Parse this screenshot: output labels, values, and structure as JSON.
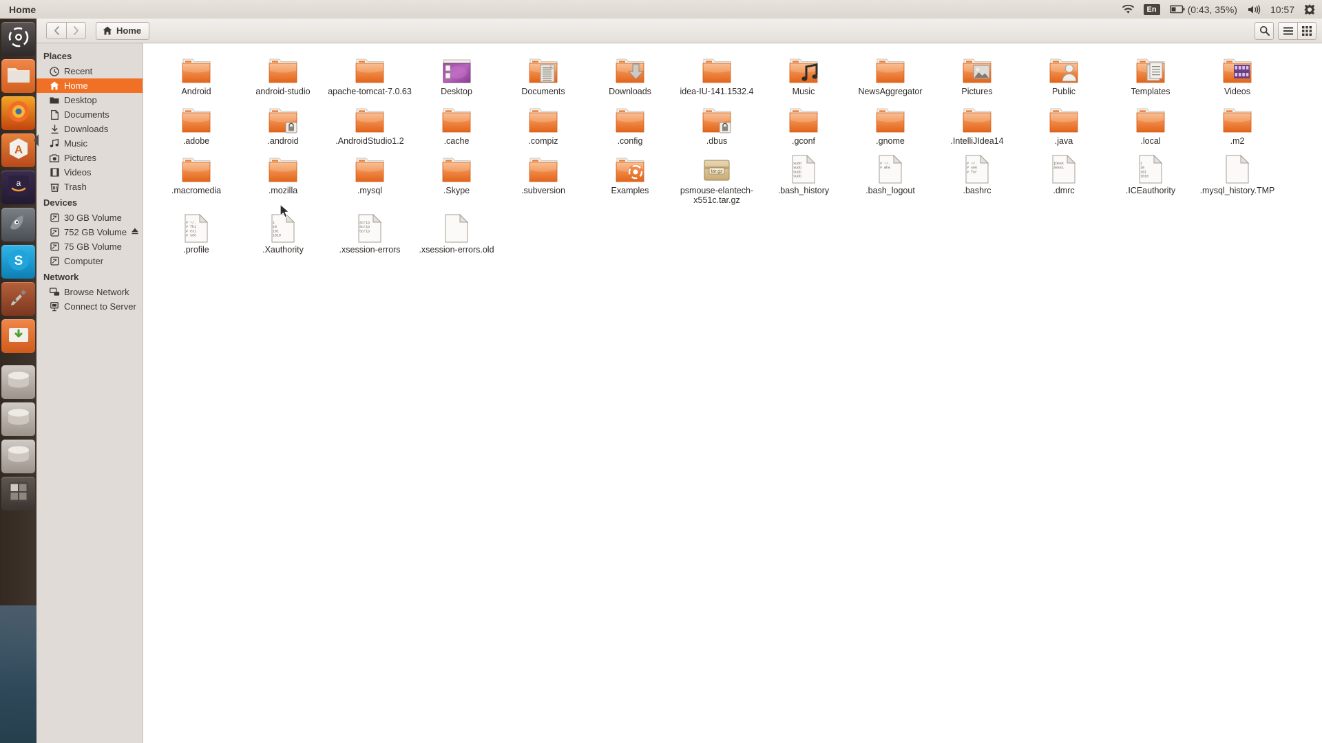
{
  "top_panel": {
    "title": "Home",
    "tray": {
      "wifi_icon": "wifi-icon",
      "keyboard_layout": "En",
      "battery_icon": "battery-icon",
      "battery_text": "(0:43, 35%)",
      "volume_icon": "volume-icon",
      "clock": "10:57",
      "session_icon": "gear-icon"
    }
  },
  "launcher": {
    "items": [
      {
        "name": "ubuntu-dash",
        "color1": "#5a5554",
        "color2": "#2e2a29",
        "glyph": "dash"
      },
      {
        "name": "files-nautilus",
        "color1": "#f0874b",
        "color2": "#d2601f",
        "glyph": "files"
      },
      {
        "name": "firefox",
        "color1": "#f5a623",
        "color2": "#c1440e",
        "glyph": "firefox"
      },
      {
        "name": "ubuntu-software-center",
        "color1": "#e8823c",
        "color2": "#b8491a",
        "glyph": "software"
      },
      {
        "name": "amazon",
        "color1": "#3a2b4e",
        "color2": "#221a30",
        "glyph": "amazon"
      },
      {
        "name": "gimp",
        "color1": "#7b7f86",
        "color2": "#4a4e54",
        "glyph": "gimp"
      },
      {
        "name": "skype",
        "color1": "#31b6e7",
        "color2": "#0d7fb5",
        "glyph": "skype"
      },
      {
        "name": "system-settings",
        "color1": "#b7603a",
        "color2": "#7a3720",
        "glyph": "settings"
      },
      {
        "name": "software-updater",
        "color1": "#f0874b",
        "color2": "#cf5b1c",
        "glyph": "updater"
      },
      {
        "name": "volume-30gb",
        "color1": "#cfcac4",
        "color2": "#9b948c",
        "glyph": "disk"
      },
      {
        "name": "volume-752gb",
        "color1": "#cfcac4",
        "color2": "#9b948c",
        "glyph": "disk"
      },
      {
        "name": "volume-75gb",
        "color1": "#cfcac4",
        "color2": "#9b948c",
        "glyph": "disk"
      },
      {
        "name": "workspace-switcher",
        "color1": "#5d5650",
        "color2": "#3a3531",
        "glyph": "workspace"
      }
    ]
  },
  "toolbar": {
    "back_label": "Back",
    "forward_label": "Forward",
    "path_label": "Home",
    "search_label": "Search",
    "view_list_label": "List view",
    "view_grid_label": "Icon view"
  },
  "sidebar": {
    "groups": [
      {
        "heading": "Places",
        "items": [
          {
            "label": "Recent",
            "icon": "clock-icon",
            "active": false
          },
          {
            "label": "Home",
            "icon": "home-icon",
            "active": true
          },
          {
            "label": "Desktop",
            "icon": "folder-icon",
            "active": false
          },
          {
            "label": "Documents",
            "icon": "document-icon",
            "active": false
          },
          {
            "label": "Downloads",
            "icon": "download-icon",
            "active": false
          },
          {
            "label": "Music",
            "icon": "music-icon",
            "active": false
          },
          {
            "label": "Pictures",
            "icon": "camera-icon",
            "active": false
          },
          {
            "label": "Videos",
            "icon": "film-icon",
            "active": false
          },
          {
            "label": "Trash",
            "icon": "trash-icon",
            "active": false
          }
        ]
      },
      {
        "heading": "Devices",
        "items": [
          {
            "label": "30 GB Volume",
            "icon": "drive-icon",
            "active": false
          },
          {
            "label": "752 GB Volume",
            "icon": "drive-icon",
            "active": false,
            "eject": true
          },
          {
            "label": "75 GB Volume",
            "icon": "drive-icon",
            "active": false
          },
          {
            "label": "Computer",
            "icon": "drive-icon",
            "active": false
          }
        ]
      },
      {
        "heading": "Network",
        "items": [
          {
            "label": "Browse Network",
            "icon": "network-icon",
            "active": false
          },
          {
            "label": "Connect to Server",
            "icon": "server-icon",
            "active": false
          }
        ]
      }
    ]
  },
  "files": [
    {
      "label": "Android",
      "type": "folder"
    },
    {
      "label": "android-studio",
      "type": "folder"
    },
    {
      "label": "apache-tomcat-7.0.63",
      "type": "folder"
    },
    {
      "label": "Desktop",
      "type": "folder-desktop"
    },
    {
      "label": "Documents",
      "type": "folder-documents"
    },
    {
      "label": "Downloads",
      "type": "folder-downloads"
    },
    {
      "label": "idea-IU-141.1532.4",
      "type": "folder"
    },
    {
      "label": "Music",
      "type": "folder-music"
    },
    {
      "label": "NewsAggregator",
      "type": "folder"
    },
    {
      "label": "Pictures",
      "type": "folder-pictures"
    },
    {
      "label": "Public",
      "type": "folder-public"
    },
    {
      "label": "Templates",
      "type": "folder-templates"
    },
    {
      "label": "Videos",
      "type": "folder-videos"
    },
    {
      "label": ".adobe",
      "type": "folder"
    },
    {
      "label": ".android",
      "type": "folder-locked"
    },
    {
      "label": ".AndroidStudio1.2",
      "type": "folder"
    },
    {
      "label": ".cache",
      "type": "folder"
    },
    {
      "label": ".compiz",
      "type": "folder"
    },
    {
      "label": ".config",
      "type": "folder"
    },
    {
      "label": ".dbus",
      "type": "folder-locked"
    },
    {
      "label": ".gconf",
      "type": "folder"
    },
    {
      "label": ".gnome",
      "type": "folder"
    },
    {
      "label": ".IntelliJIdea14",
      "type": "folder"
    },
    {
      "label": ".java",
      "type": "folder"
    },
    {
      "label": ".local",
      "type": "folder"
    },
    {
      "label": ".m2",
      "type": "folder"
    },
    {
      "label": ".macromedia",
      "type": "folder"
    },
    {
      "label": ".mozilla",
      "type": "folder"
    },
    {
      "label": ".mysql",
      "type": "folder"
    },
    {
      "label": ".Skype",
      "type": "folder"
    },
    {
      "label": ".subversion",
      "type": "folder"
    },
    {
      "label": "Examples",
      "type": "folder-examples"
    },
    {
      "label": "psmouse-elantech-x551c.tar.gz",
      "type": "archive"
    },
    {
      "label": ".bash_history",
      "type": "text",
      "preview": [
        "sudo",
        "sudo",
        "sudo",
        "sudo"
      ]
    },
    {
      "label": ".bash_logout",
      "type": "text",
      "preview": [
        "# ~/.",
        "# whe"
      ]
    },
    {
      "label": ".bashrc",
      "type": "text",
      "preview": [
        "# ~/.",
        "# see",
        "# for"
      ]
    },
    {
      "label": ".dmrc",
      "type": "text",
      "preview": [
        "[Desk",
        "Sessi"
      ]
    },
    {
      "label": ".ICEauthority",
      "type": "text",
      "preview": [
        "1",
        "10",
        "101",
        "1010"
      ]
    },
    {
      "label": ".mysql_history.TMP",
      "type": "text",
      "preview": []
    },
    {
      "label": ".profile",
      "type": "text",
      "preview": [
        "# ~/.",
        "# Thi",
        "# exi",
        "# see"
      ]
    },
    {
      "label": ".Xauthority",
      "type": "text",
      "preview": [
        "1",
        "10",
        "101",
        "1010"
      ]
    },
    {
      "label": ".xsession-errors",
      "type": "text",
      "preview": [
        "Scrip",
        "Scrip",
        "Scrip"
      ]
    },
    {
      "label": ".xsession-errors.old",
      "type": "text",
      "preview": []
    }
  ],
  "colors": {
    "accent": "#f07025",
    "folder_orange": "#e8712a",
    "folder_orange_light": "#f7ad73",
    "desktop_purple": "#9c4fa0",
    "panel_dark": "#3c3834",
    "sidebar_bg": "#e0dbd6"
  }
}
